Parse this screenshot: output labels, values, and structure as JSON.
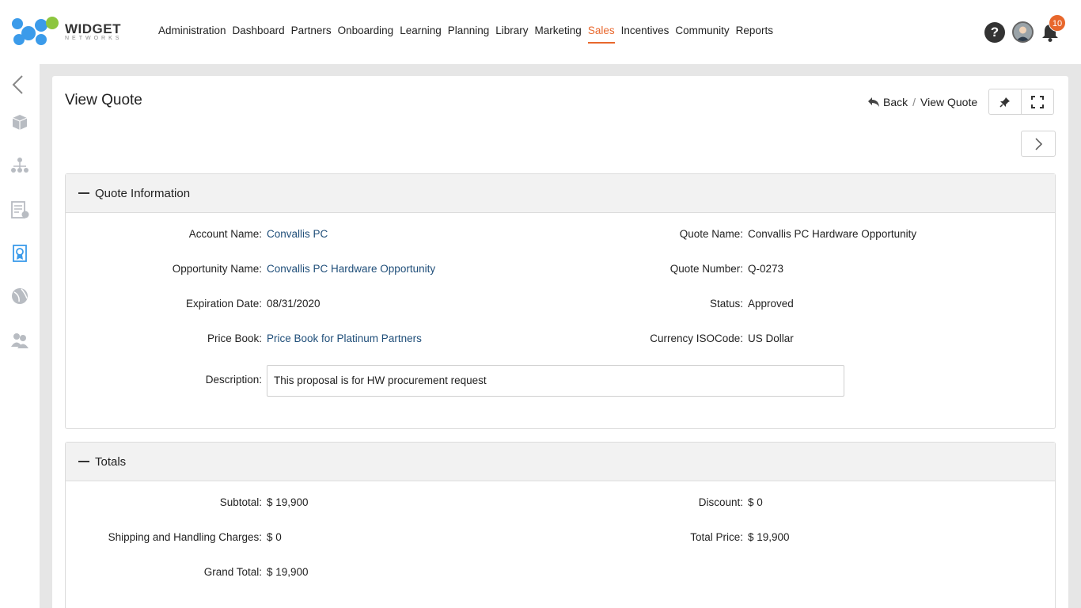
{
  "brand": {
    "name": "WIDGET",
    "tagline": "NETWORKS",
    "colors": {
      "primary": "#3b9bea",
      "accent": "#8dc63f",
      "active": "#e8672c"
    }
  },
  "nav": {
    "items": [
      "Administration",
      "Dashboard",
      "Partners",
      "Onboarding",
      "Learning",
      "Planning",
      "Library",
      "Marketing",
      "Sales",
      "Incentives",
      "Community",
      "Reports"
    ],
    "active": "Sales"
  },
  "header_icons": {
    "help": "help-icon",
    "avatar": "user-avatar",
    "bell": "bell-icon",
    "notification_count": "10"
  },
  "sidebar": {
    "icons": [
      "collapse-chevron-icon",
      "box-icon",
      "org-chart-icon",
      "invoice-icon",
      "certificate-icon",
      "globe-icon",
      "users-icon"
    ]
  },
  "page": {
    "title": "View Quote",
    "breadcrumb": {
      "back": "Back",
      "sep": "/",
      "current": "View Quote"
    }
  },
  "quote_info": {
    "header": "Quote Information",
    "left": [
      {
        "label": "Account Name:",
        "value": "Convallis PC",
        "link": true
      },
      {
        "label": "Opportunity Name:",
        "value": "Convallis PC Hardware Opportunity",
        "link": true
      },
      {
        "label": "Expiration Date:",
        "value": "08/31/2020",
        "link": false
      },
      {
        "label": "Price Book:",
        "value": "Price Book for Platinum Partners",
        "link": true
      }
    ],
    "right": [
      {
        "label": "Quote Name:",
        "value": "Convallis PC Hardware Opportunity"
      },
      {
        "label": "Quote Number:",
        "value": "Q-0273"
      },
      {
        "label": "Status:",
        "value": "Approved"
      },
      {
        "label": "Currency ISOCode:",
        "value": "US Dollar"
      }
    ],
    "description": {
      "label": "Description:",
      "value": "This proposal is for HW procurement request"
    }
  },
  "totals": {
    "header": "Totals",
    "left": [
      {
        "label": "Subtotal:",
        "value": "$ 19,900"
      },
      {
        "label": "Shipping and Handling Charges:",
        "value": "$ 0"
      },
      {
        "label": "Grand Total:",
        "value": "$ 19,900"
      }
    ],
    "right": [
      {
        "label": "Discount:",
        "value": "$ 0"
      },
      {
        "label": "Total Price:",
        "value": "$ 19,900"
      }
    ]
  }
}
